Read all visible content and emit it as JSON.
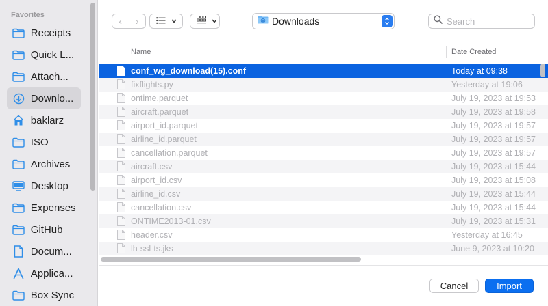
{
  "sidebar": {
    "heading": "Favorites",
    "items": [
      {
        "label": "Receipts",
        "icon": "folder-icon"
      },
      {
        "label": "Quick L...",
        "icon": "folder-icon"
      },
      {
        "label": "Attach...",
        "icon": "folder-icon"
      },
      {
        "label": "Downlo...",
        "icon": "download-icon",
        "selected": true
      },
      {
        "label": "baklarz",
        "icon": "home-icon"
      },
      {
        "label": "ISO",
        "icon": "folder-icon"
      },
      {
        "label": "Archives",
        "icon": "folder-icon"
      },
      {
        "label": "Desktop",
        "icon": "desktop-icon"
      },
      {
        "label": "Expenses",
        "icon": "folder-icon"
      },
      {
        "label": "GitHub",
        "icon": "folder-icon"
      },
      {
        "label": "Docum...",
        "icon": "document-icon"
      },
      {
        "label": "Applica...",
        "icon": "applications-icon"
      },
      {
        "label": "Box Sync",
        "icon": "folder-icon"
      }
    ]
  },
  "toolbar": {
    "back_glyph": "‹",
    "forward_glyph": "›",
    "location": "Downloads",
    "search_placeholder": "Search"
  },
  "table": {
    "col_name": "Name",
    "col_date": "Date Created",
    "rows": [
      {
        "name": "conf_wg_download(15).conf",
        "date": "Today at 09:38",
        "selected": true
      },
      {
        "name": "fixflights.py",
        "date": "Yesterday at 19:06"
      },
      {
        "name": "ontime.parquet",
        "date": "July 19, 2023 at 19:53"
      },
      {
        "name": "aircraft.parquet",
        "date": "July 19, 2023 at 19:58"
      },
      {
        "name": "airport_id.parquet",
        "date": "July 19, 2023 at 19:57"
      },
      {
        "name": "airline_id.parquet",
        "date": "July 19, 2023 at 19:57"
      },
      {
        "name": "cancellation.parquet",
        "date": "July 19, 2023 at 19:57"
      },
      {
        "name": "aircraft.csv",
        "date": "July 19, 2023 at 15:44"
      },
      {
        "name": "airport_id.csv",
        "date": "July 19, 2023 at 15:08"
      },
      {
        "name": "airline_id.csv",
        "date": "July 19, 2023 at 15:44"
      },
      {
        "name": "cancellation.csv",
        "date": "July 19, 2023 at 15:44"
      },
      {
        "name": "ONTIME2013-01.csv",
        "date": "July 19, 2023 at 15:31"
      },
      {
        "name": "header.csv",
        "date": "Yesterday at 16:45"
      },
      {
        "name": "lh-ssl-ts.jks",
        "date": "June 9, 2023 at 10:20"
      }
    ]
  },
  "footer": {
    "cancel_label": "Cancel",
    "import_label": "Import"
  },
  "colors": {
    "accent": "#0b63e0",
    "sidebar_bg": "#eae9ec",
    "folder_icon": "#2f8ee8"
  }
}
